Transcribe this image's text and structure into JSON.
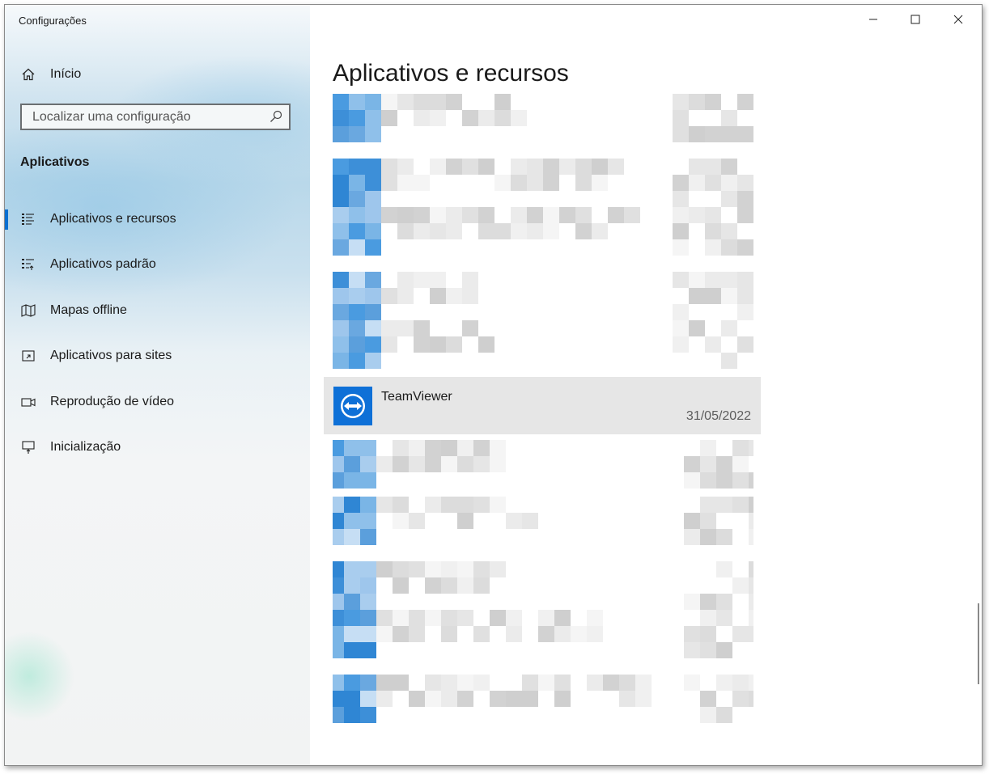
{
  "window": {
    "title": "Configurações",
    "controls": {
      "minimize": "—",
      "maximize": "☐",
      "close": "✕"
    }
  },
  "sidebar": {
    "home_label": "Início",
    "search_placeholder": "Localizar uma configuração",
    "section_title": "Aplicativos",
    "items": [
      {
        "label": "Aplicativos e recursos",
        "icon": "apps-features-icon",
        "active": true
      },
      {
        "label": "Aplicativos padrão",
        "icon": "default-apps-icon",
        "active": false
      },
      {
        "label": "Mapas offline",
        "icon": "offline-maps-icon",
        "active": false
      },
      {
        "label": "Aplicativos para sites",
        "icon": "apps-for-websites-icon",
        "active": false
      },
      {
        "label": "Reprodução de vídeo",
        "icon": "video-playback-icon",
        "active": false
      },
      {
        "label": "Inicialização",
        "icon": "startup-icon",
        "active": false
      }
    ]
  },
  "main": {
    "page_title": "Aplicativos e recursos",
    "selected_app": {
      "name": "TeamViewer",
      "date": "31/05/2022",
      "icon": "teamviewer-icon"
    }
  },
  "colors": {
    "accent": "#0a6fd1",
    "teamviewer_blue": "#0e70d7",
    "selected_row": "#e6e6e6"
  }
}
